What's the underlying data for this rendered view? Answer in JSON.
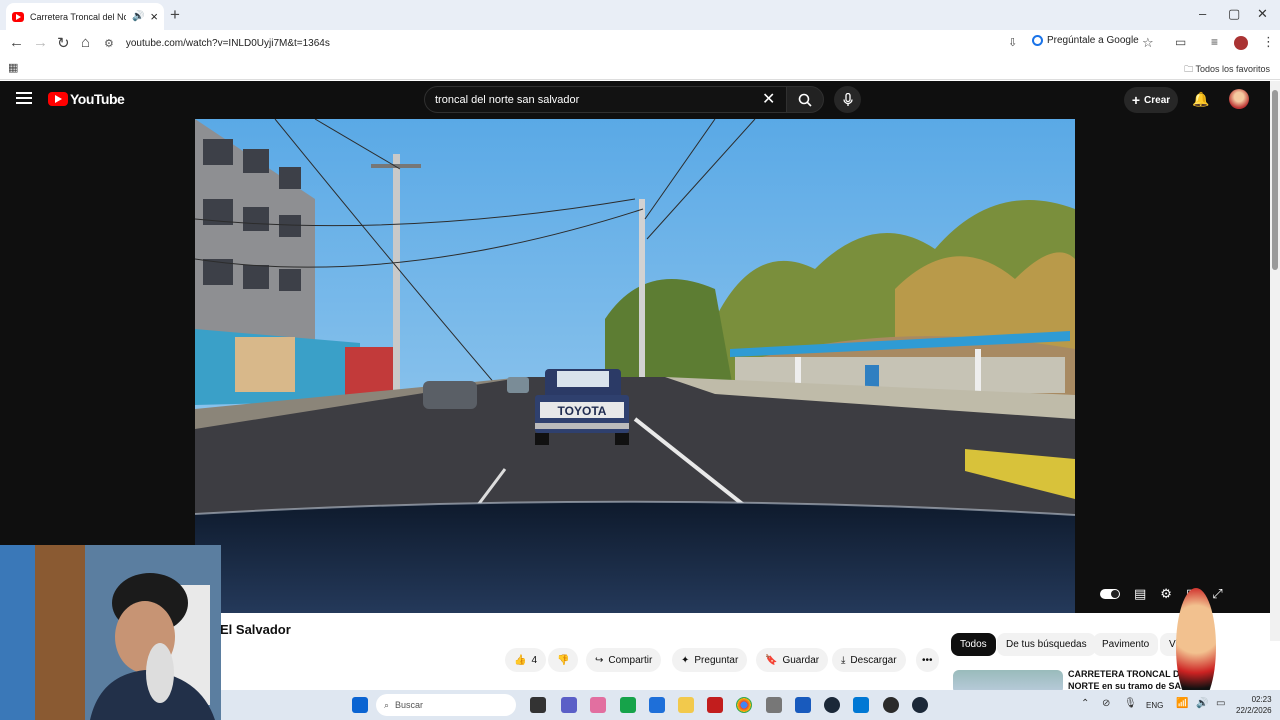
{
  "browser": {
    "tab_title": "Carretera Troncal del Norte",
    "tab_audio_icon": "speaker-icon",
    "new_tab": "+",
    "url": "youtube.com/watch?v=INLD0Uyji7M&t=1364s",
    "gemini_label": "Pregúntale a Google",
    "bookmarks_label": "Todos los favoritos",
    "window_min": "–",
    "window_max": "▢",
    "window_close": "✕"
  },
  "youtube": {
    "logo_text": "YouTube",
    "search_query": "troncal del norte san salvador",
    "create_label": "Crear",
    "video_title": "El Salvador",
    "likes": "4",
    "actions": {
      "share": "Compartir",
      "ask": "Preguntar",
      "save": "Guardar",
      "download": "Descargar"
    },
    "chips": [
      "Todos",
      "De tus búsquedas",
      "Pavimento",
      "Vi"
    ],
    "recommendation_title": "CARRETERA TRONCAL DEL NORTE en su tramo de SAN",
    "truck_brand": "TOYOTA"
  },
  "taskbar": {
    "search_placeholder": "Buscar",
    "language": "ENG",
    "time": "02:23",
    "date": "22/2/2026"
  },
  "colors": {
    "yt_red": "#ff0000",
    "yt_dark": "#0f0f0f",
    "sky": "#6fb6e8",
    "road": "#3d3d42"
  }
}
